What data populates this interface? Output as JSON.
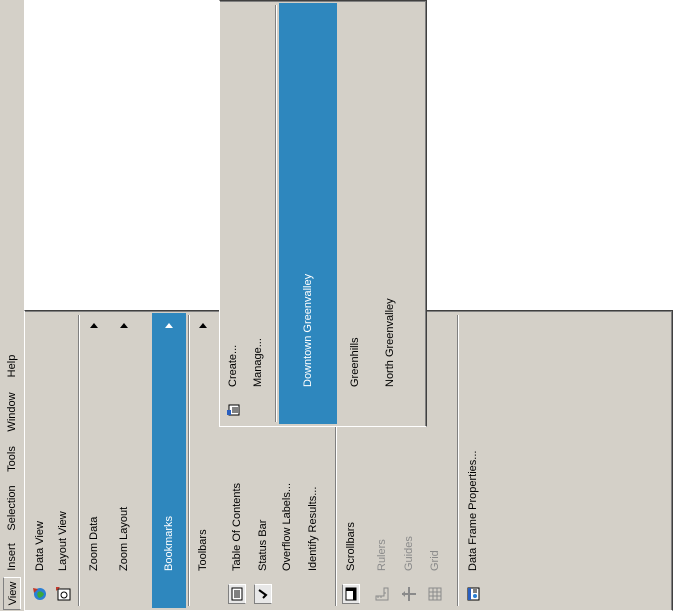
{
  "menubar": {
    "items": [
      {
        "label": "View",
        "hot": "V"
      },
      {
        "label": "Insert",
        "hot": "I"
      },
      {
        "label": "Selection",
        "hot": "S"
      },
      {
        "label": "Tools",
        "hot": "T"
      },
      {
        "label": "Window",
        "hot": "W"
      },
      {
        "label": "Help",
        "hot": "H"
      }
    ]
  },
  "view_menu": {
    "items": [
      {
        "label": "Data View",
        "icon": "globe-data-view-icon"
      },
      {
        "label": "Layout View",
        "icon": "page-layout-view-icon"
      },
      {
        "label": "Zoom Data",
        "submenu": true
      },
      {
        "label": "Zoom Layout",
        "submenu": true
      },
      {
        "label": "Bookmarks",
        "submenu": true,
        "selected": true
      },
      {
        "label": "Toolbars",
        "submenu": true
      },
      {
        "label": "Table Of Contents",
        "icon": "table-of-contents-icon",
        "checked": true
      },
      {
        "label": "Status Bar",
        "icon": "check-icon",
        "checked": true
      },
      {
        "label": "Overflow Labels..."
      },
      {
        "label": "Identify Results..."
      },
      {
        "label": "Scrollbars",
        "icon": "scrollbars-icon",
        "checked": true
      },
      {
        "label": "Rulers",
        "icon": "rulers-icon",
        "disabled": true
      },
      {
        "label": "Guides",
        "icon": "guides-icon",
        "disabled": true
      },
      {
        "label": "Grid",
        "icon": "grid-icon",
        "disabled": true
      },
      {
        "label": "Data Frame Properties...",
        "icon": "data-frame-icon"
      }
    ]
  },
  "bookmarks_menu": {
    "items": [
      {
        "label": "Create...",
        "icon": "bookmark-create-icon"
      },
      {
        "label": "Manage..."
      },
      {
        "label": "Downtown Greenvalley",
        "selected": true
      },
      {
        "label": "Greenhills"
      },
      {
        "label": "North Greenvalley"
      }
    ]
  }
}
